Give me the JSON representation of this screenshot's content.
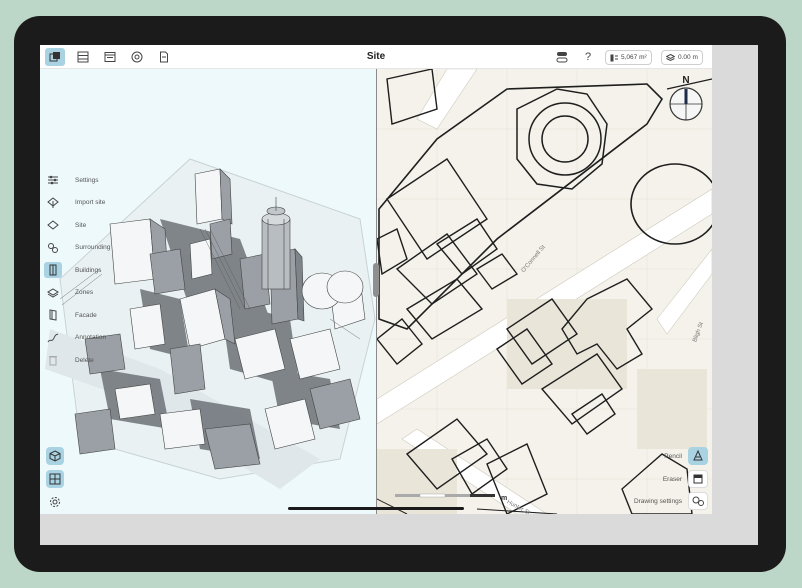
{
  "app": {
    "title": "Site"
  },
  "toolbar": {
    "buttons": [
      {
        "icon": "layers-view-icon",
        "active": true
      },
      {
        "icon": "table-icon",
        "active": false
      },
      {
        "icon": "window-icon",
        "active": false
      },
      {
        "icon": "clock-icon",
        "active": false
      },
      {
        "icon": "document-icon",
        "active": false
      }
    ],
    "help_label": "?",
    "area_value": "5,067 m²",
    "elevation_value": "0.00 m"
  },
  "sidebar": {
    "items": [
      {
        "label": "Settings",
        "icon": "sliders-icon",
        "active": false
      },
      {
        "label": "Import site",
        "icon": "import-site-icon",
        "active": false
      },
      {
        "label": "Site",
        "icon": "site-diamond-icon",
        "active": false
      },
      {
        "label": "Surrounding",
        "icon": "surrounding-icon",
        "active": false
      },
      {
        "label": "Buildings",
        "icon": "buildings-icon",
        "active": true
      },
      {
        "label": "Zones",
        "icon": "zones-icon",
        "active": false
      },
      {
        "label": "Facade",
        "icon": "facade-icon",
        "active": false
      },
      {
        "label": "Annotation",
        "icon": "annotation-pen-icon",
        "active": false
      },
      {
        "label": "Delete",
        "icon": "trash-icon",
        "active": false
      }
    ]
  },
  "bottom_tools": [
    {
      "icon": "3d-cube-icon",
      "active": true
    },
    {
      "icon": "plan-grid-icon",
      "active": true
    },
    {
      "icon": "gear-icon",
      "active": false
    }
  ],
  "map": {
    "compass_label": "N",
    "streets": [
      "O'Connell St",
      "Hunter St",
      "Bligh St"
    ],
    "scale_label": "m"
  },
  "drawing_tools": {
    "pencil_label": "Pencil",
    "eraser_label": "Eraser",
    "settings_label": "Drawing settings"
  },
  "colors": {
    "accent": "#a9d3e3",
    "map_bg": "#f4f2ea",
    "model_bg": "#eef9fc",
    "device": "#1b1b1b"
  }
}
